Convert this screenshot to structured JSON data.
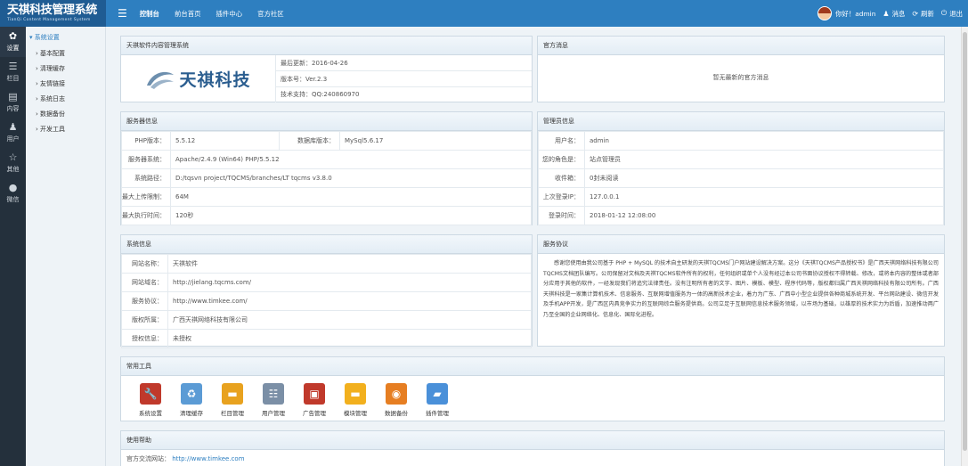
{
  "app": {
    "title": "天祺科技管理系统",
    "subtitle": "TianQi Content Management System"
  },
  "topnav": [
    "控制台",
    "前台首页",
    "插件中心",
    "官方社区"
  ],
  "user": {
    "greeting": "你好！admin",
    "messages": "消息",
    "refresh": "刷新",
    "logout": "退出"
  },
  "sidebar": [
    {
      "icon": "gear-icon",
      "label": "设置"
    },
    {
      "icon": "list-icon",
      "label": "栏目"
    },
    {
      "icon": "document-icon",
      "label": "内容"
    },
    {
      "icon": "user-icon",
      "label": "用户"
    },
    {
      "icon": "star-icon",
      "label": "其他"
    },
    {
      "icon": "wechat-icon",
      "label": "微信"
    }
  ],
  "tree": {
    "header": "系统设置",
    "items": [
      "基本配置",
      "清理缓存",
      "友情链接",
      "系统日志",
      "数据备份",
      "开发工具"
    ]
  },
  "product": {
    "title": "天祺软件内容管理系统",
    "logo_text": "天祺科技",
    "rows": [
      "最后更新：2016-04-26",
      "版本号：Ver.2.3",
      "技术支持：QQ:240860970"
    ]
  },
  "notice": {
    "title": "官方消息",
    "empty": "暂无最新的官方消息"
  },
  "server": {
    "title": "服务器信息",
    "php_label": "PHP版本：",
    "php_value": "5.5.12",
    "db_label": "数据库版本：",
    "db_value": "MySql5.6.17",
    "rows": [
      {
        "label": "服务器系统：",
        "value": "Apache/2.4.9 (Win64) PHP/5.5.12"
      },
      {
        "label": "系统路径：",
        "value": "D:/tqsvn project/TQCMS/branches/LT tqcms v3.8.0"
      },
      {
        "label": "最大上传限制：",
        "value": "64M"
      },
      {
        "label": "最大执行时间：",
        "value": "120秒"
      }
    ]
  },
  "admin": {
    "title": "管理员信息",
    "rows": [
      {
        "label": "用户名：",
        "value": "admin"
      },
      {
        "label": "您的角色是：",
        "value": "站点管理员"
      },
      {
        "label": "收件箱：",
        "value": "0封未阅读"
      },
      {
        "label": "上次登录IP：",
        "value": "127.0.0.1"
      },
      {
        "label": "登录时间：",
        "value": "2018-01-12 12:08:00"
      }
    ]
  },
  "system": {
    "title": "系统信息",
    "rows": [
      {
        "label": "网站名称：",
        "value": "天祺软件"
      },
      {
        "label": "网站域名：",
        "value": "http://jielang.tqcms.com/"
      },
      {
        "label": "服务协议：",
        "value": "http://www.timkee.com/"
      },
      {
        "label": "版权所属：",
        "value": "广西天祺网络科技有限公司"
      },
      {
        "label": "授权信息：",
        "value": "未授权"
      }
    ]
  },
  "license": {
    "title": "服务协议",
    "text": "感谢您使用由我公司基于 PHP + MySQL 的技术自主研发的天祺TQCMS门户网站建设解决方案。这分《天祺TQCMS产品授权书》是广西天祺网络科技有限公司TQCMS文档团队编写。公司保留对文档及天祺TQCMS软件所有的权利，任何组织或单个人没有经过本公司书面协议授权不得转载、修改，或将本内容的整体或者部分应用于其他的软件，一经发现我们将追究法律责任。没有注明所有者的文字、图片、模板、模型、程序代码等，版权都归属广西天祺网络科技有限公司所有。广西天祺科技是一家集计算机技术、信息服务、互联网增值服务为一体的高新技术企业，着力为广东、广西中小型企业提供各种商城系统开发、平台网站建设、微信开发及手机APP开发，是广西区内具竞争实力的互联网综合服务提供商。公司立足于互联网信息技术服务领域，以市场为基础，以雄厚的技术实力为后盾，加速推动两广乃至全国的企业网络化、信息化、国际化进程。"
  },
  "tools": {
    "title": "常用工具",
    "items": [
      {
        "icon": "tools-icon",
        "label": "系统设置",
        "color": "#c0392b"
      },
      {
        "icon": "recycle-bin-icon",
        "label": "清理缓存",
        "color": "#5b9bd5"
      },
      {
        "icon": "folder-icon",
        "label": "栏目管理",
        "color": "#e8a21f"
      },
      {
        "icon": "users-icon",
        "label": "用户管理",
        "color": "#7b8fa6"
      },
      {
        "icon": "billboard-icon",
        "label": "广告管理",
        "color": "#c0392b"
      },
      {
        "icon": "module-folder-icon",
        "label": "模块管理",
        "color": "#f2b01e"
      },
      {
        "icon": "database-icon",
        "label": "数据备份",
        "color": "#e67e22"
      },
      {
        "icon": "plugin-icon",
        "label": "插件管理",
        "color": "#4a90d9"
      }
    ]
  },
  "help": {
    "title": "使用帮助",
    "site_label": "官方交流网站：",
    "site_value": "http://www.timkee.com"
  }
}
